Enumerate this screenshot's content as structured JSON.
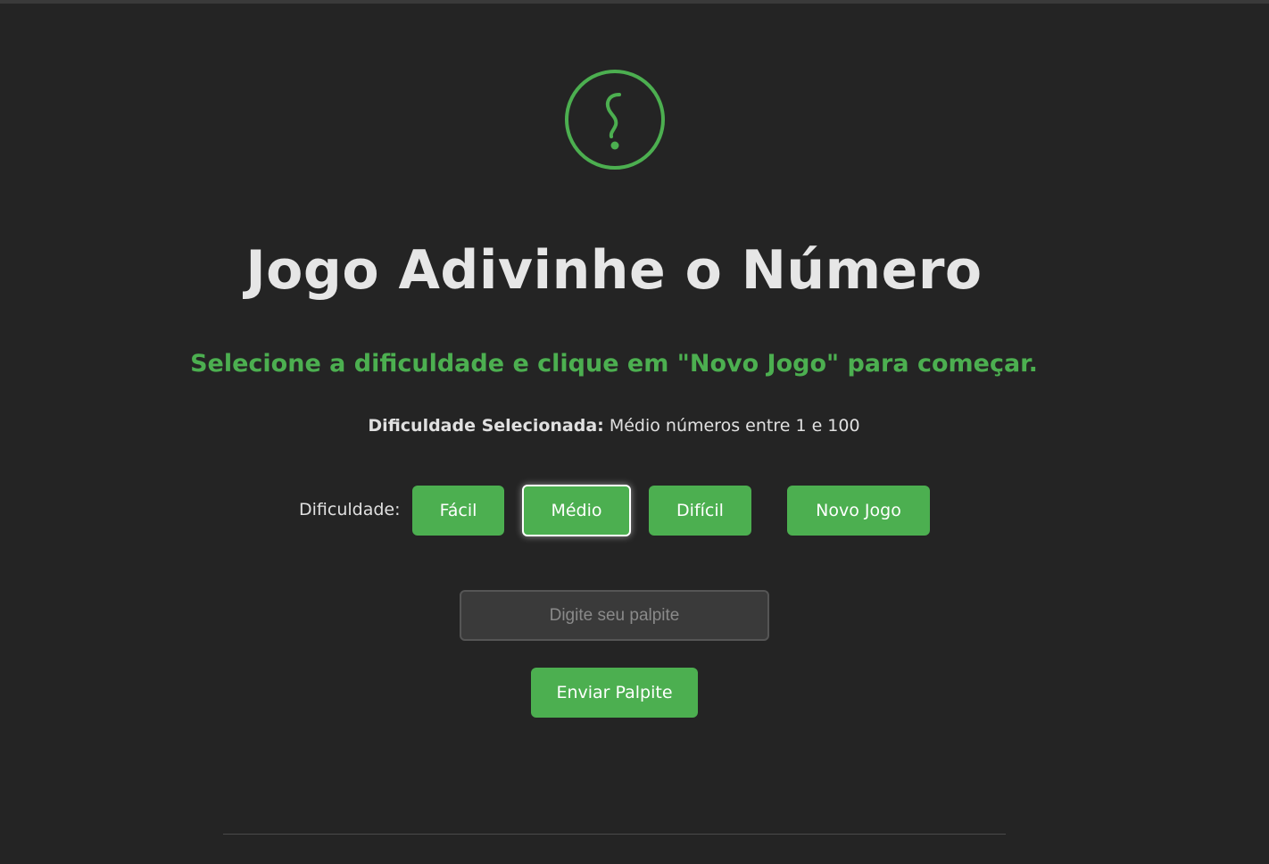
{
  "title": "Jogo Adivinhe o Número",
  "message": "Selecione a dificuldade e clique em \"Novo Jogo\" para começar.",
  "selected_difficulty": {
    "label": "Dificuldade Selecionada:",
    "value": "Médio números entre 1 e 100"
  },
  "difficulty": {
    "label": "Dificuldade:",
    "options": [
      "Fácil",
      "Médio",
      "Difícil"
    ],
    "selected": "Médio"
  },
  "new_game_label": "Novo Jogo",
  "guess": {
    "placeholder": "Digite seu palpite",
    "value": ""
  },
  "submit_label": "Enviar Palpite",
  "colors": {
    "background": "#242424",
    "accent": "#4caf50",
    "text": "#e6e6e6"
  },
  "icons": {
    "logo": "question-mark-circle-icon"
  }
}
